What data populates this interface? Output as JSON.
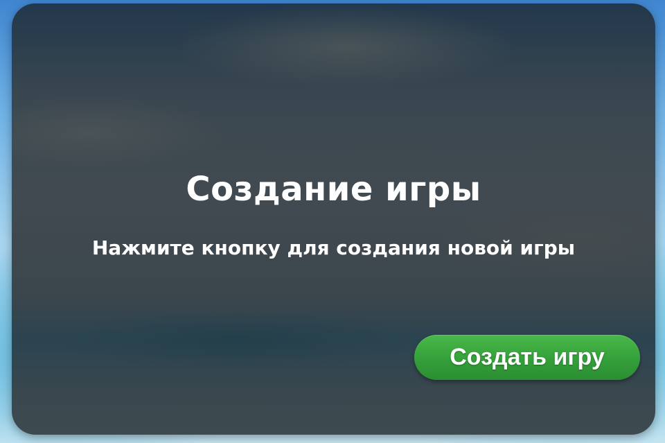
{
  "dialog": {
    "title": "Создание игры",
    "subtitle": "Нажмите кнопку для создания новой игры",
    "create_button_label": "Создать игру"
  },
  "colors": {
    "accent_button": "#34a03a",
    "panel_background": "#3b464d",
    "text": "#ffffff"
  }
}
